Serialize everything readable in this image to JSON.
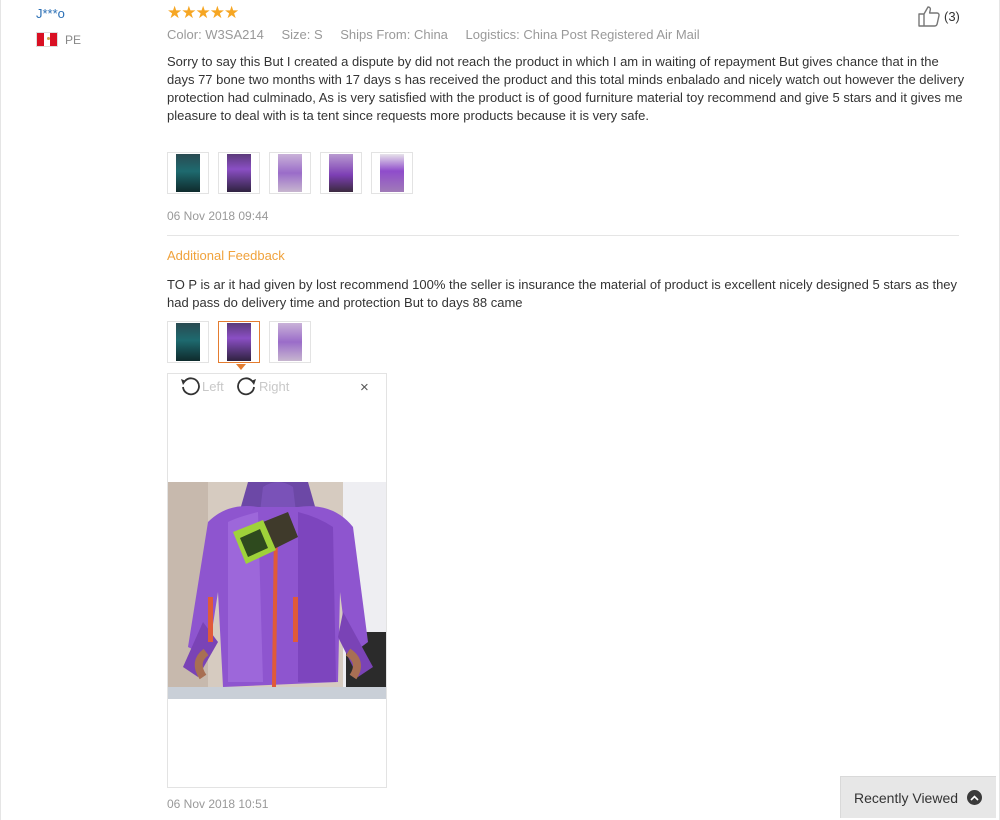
{
  "user": {
    "name": "J***o",
    "country": "PE"
  },
  "review": {
    "rating": 5,
    "helpful_count": "(3)",
    "meta": {
      "color": "Color: W3SA214",
      "size": "Size: S",
      "ships_from": "Ships From: China",
      "logistics": "Logistics: China Post Registered Air Mail"
    },
    "text": "Sorry to say this But I created a dispute by did not reach the product in which I am in waiting of repayment But gives chance that in the days 77 bone two months with 17 days s has received the product and this total minds enbalado and nicely watch out however the delivery protection had culminado, As is very satisfied with the product is of good furniture material toy recommend and give 5 stars and it gives me pleasure to deal with is ta tent since requests more products because it is very safe.",
    "date": "06 Nov 2018 09:44"
  },
  "additional_feedback": {
    "title": "Additional Feedback",
    "text": "TO P is ar it had given by lost recommend 100% the seller is insurance the material of product is excellent nicely designed 5 stars as they had pass do delivery time and protection But to days 88 came",
    "date": "06 Nov 2018 10:51"
  },
  "viewer": {
    "left_label": "Left",
    "right_label": "Right",
    "close_label": "×"
  },
  "recently_viewed": {
    "label": "Recently Viewed"
  },
  "colors": {
    "star": "#f6a623",
    "accent": "#e47c2f",
    "link": "#2a6fb5",
    "feedback_title": "#f0a23c"
  }
}
